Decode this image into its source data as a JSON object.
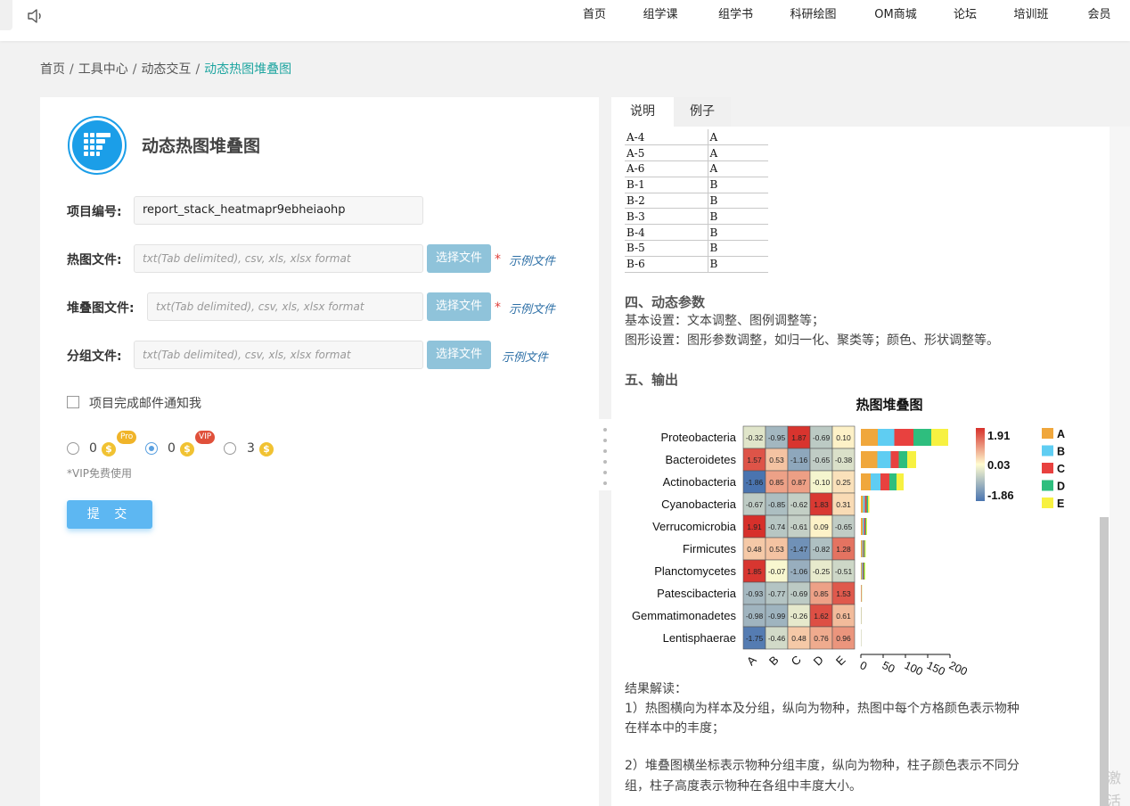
{
  "nav": {
    "items": [
      "首页",
      "组学课",
      "组学书",
      "科研绘图",
      "OM商城",
      "论坛",
      "培训班",
      "会员"
    ]
  },
  "breadcrumb": {
    "items": [
      "首页",
      "工具中心",
      "动态交互"
    ],
    "current": "动态热图堆叠图",
    "sep": "/"
  },
  "form": {
    "title": "动态热图堆叠图",
    "project_label": "项目编号:",
    "project_value": "report_stack_heatmapr9ebheiaohp",
    "heatmap_label": "热图文件:",
    "stack_label": "堆叠图文件:",
    "group_label": "分组文件:",
    "file_placeholder": "txt(Tab delimited), csv, xls, xlsx format",
    "choose_button": "选择文件",
    "required_mark": "*",
    "example_link": "示例文件",
    "email_notify": "项目完成邮件通知我",
    "options": [
      {
        "value": "0",
        "badge": "Pro",
        "selected": false
      },
      {
        "value": "0",
        "badge": "VIP",
        "selected": true
      },
      {
        "value": "3",
        "badge": "",
        "selected": false
      }
    ],
    "coin_symbol": "$",
    "vip_note": "*VIP免费使用",
    "submit": "提 交"
  },
  "tabs": [
    "说明",
    "例子"
  ],
  "doc": {
    "group_rows": [
      [
        "A-4",
        "A"
      ],
      [
        "A-5",
        "A"
      ],
      [
        "A-6",
        "A"
      ],
      [
        "B-1",
        "B"
      ],
      [
        "B-2",
        "B"
      ],
      [
        "B-3",
        "B"
      ],
      [
        "B-4",
        "B"
      ],
      [
        "B-5",
        "B"
      ],
      [
        "B-6",
        "B"
      ]
    ],
    "section4_title": "四、动态参数",
    "section4_line1": "基本设置：文本调整、图例调整等；",
    "section4_line2": "图形设置：图形参数调整，如归一化、聚类等；颜色、形状调整等。",
    "section5_title": "五、输出",
    "interpret_title": "结果解读：",
    "interpret_1a": "1）热图横向为样本及分组，纵向为物种，热图中每个方格颜色表示物种",
    "interpret_1b": "在样本中的丰度；",
    "interpret_2a": "2）堆叠图横坐标表示物种分组丰度，纵向为物种，柱子颜色表示不同分",
    "interpret_2b": "组，柱子高度表示物种在各组中丰度大小。"
  },
  "watermark": {
    "line1": "激活",
    "line2": "转到"
  },
  "chart_data": {
    "type": "heatmap",
    "title": "热图堆叠图",
    "rows": [
      "Proteobacteria",
      "Bacteroidetes",
      "Actinobacteria",
      "Cyanobacteria",
      "Verrucomicrobia",
      "Firmicutes",
      "Planctomycetes",
      "Patescibacteria",
      "Gemmatimonadetes",
      "Lentisphaerae"
    ],
    "columns": [
      "A",
      "B",
      "C",
      "D",
      "E"
    ],
    "values": [
      [
        -0.32,
        -0.95,
        1.87,
        -0.69,
        0.1
      ],
      [
        1.57,
        0.53,
        -1.16,
        -0.65,
        -0.38
      ],
      [
        -1.86,
        0.85,
        0.87,
        -0.1,
        0.25
      ],
      [
        -0.67,
        -0.85,
        -0.62,
        1.83,
        0.31
      ],
      [
        1.91,
        -0.74,
        -0.61,
        0.09,
        -0.65
      ],
      [
        0.48,
        0.53,
        -1.47,
        -0.82,
        1.28
      ],
      [
        1.85,
        -0.07,
        -1.06,
        -0.25,
        -0.51
      ],
      [
        -0.93,
        -0.77,
        -0.69,
        0.85,
        1.53
      ],
      [
        -0.98,
        -0.99,
        -0.26,
        1.62,
        0.61
      ],
      [
        -1.75,
        -0.46,
        0.48,
        0.76,
        0.96
      ]
    ],
    "colorbar": {
      "max": 1.91,
      "mid": 0.03,
      "min": -1.86,
      "colors": [
        "#4a74b0",
        "#fffcd0",
        "#d7302b"
      ]
    },
    "stack": {
      "type": "bar",
      "xlim": [
        0,
        200
      ],
      "ticks": [
        0,
        50,
        100,
        150,
        200
      ],
      "series": [
        {
          "name": "A",
          "color": "#f0a73c",
          "values": [
            38,
            37,
            22,
            5,
            4,
            3,
            2,
            1,
            0.5,
            0.3
          ]
        },
        {
          "name": "B",
          "color": "#5fcdf2",
          "values": [
            37,
            30,
            22,
            4,
            3,
            2,
            2,
            0.5,
            0.3,
            0.2
          ]
        },
        {
          "name": "C",
          "color": "#e8413f",
          "values": [
            43,
            18,
            20,
            4,
            3,
            2,
            2,
            0.5,
            0.2,
            0.2
          ]
        },
        {
          "name": "D",
          "color": "#2ebe7e",
          "values": [
            40,
            19,
            16,
            3,
            2,
            2,
            2,
            0.3,
            0.2,
            0.2
          ]
        },
        {
          "name": "E",
          "color": "#f7f141",
          "values": [
            38,
            20,
            16,
            3,
            2,
            2,
            2,
            0.3,
            0.2,
            0.1
          ]
        }
      ]
    }
  }
}
